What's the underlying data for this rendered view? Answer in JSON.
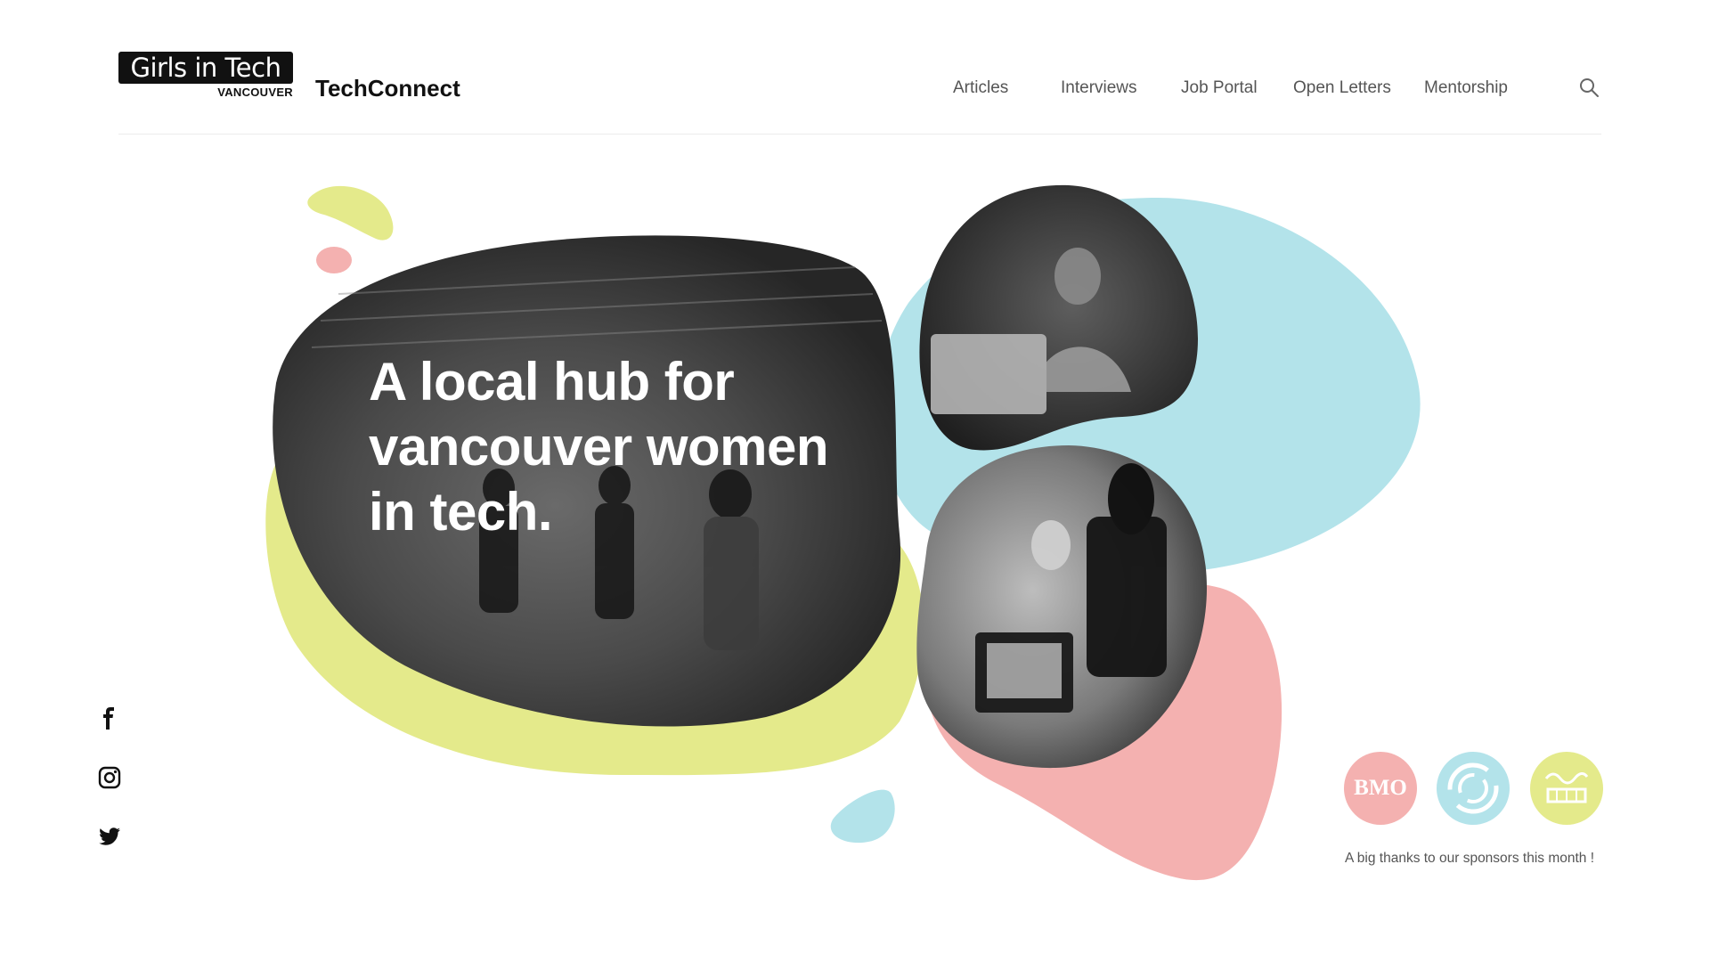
{
  "header": {
    "logo_text": "Girls in Tech",
    "logo_sub": "VANCOUVER",
    "brand": "TechConnect",
    "nav": [
      "Articles",
      "Interviews",
      "Job Portal",
      "Open Letters",
      "Mentorship"
    ]
  },
  "hero": {
    "headline": "A local hub for vancouver women in tech."
  },
  "social": {
    "icons": [
      "facebook-icon",
      "instagram-icon",
      "twitter-icon"
    ]
  },
  "sponsors": {
    "logos": [
      {
        "label": "BMO",
        "color": "#f4b1b0"
      },
      {
        "label": "",
        "color": "#b3e3ea"
      },
      {
        "label": "",
        "color": "#e4ea8b"
      }
    ],
    "caption": "A big thanks to our sponsors this month !"
  },
  "colors": {
    "yellow": "#e4ea8b",
    "blue": "#b3e3ea",
    "pink": "#f4b1b0",
    "photo_gray": "#555555"
  }
}
